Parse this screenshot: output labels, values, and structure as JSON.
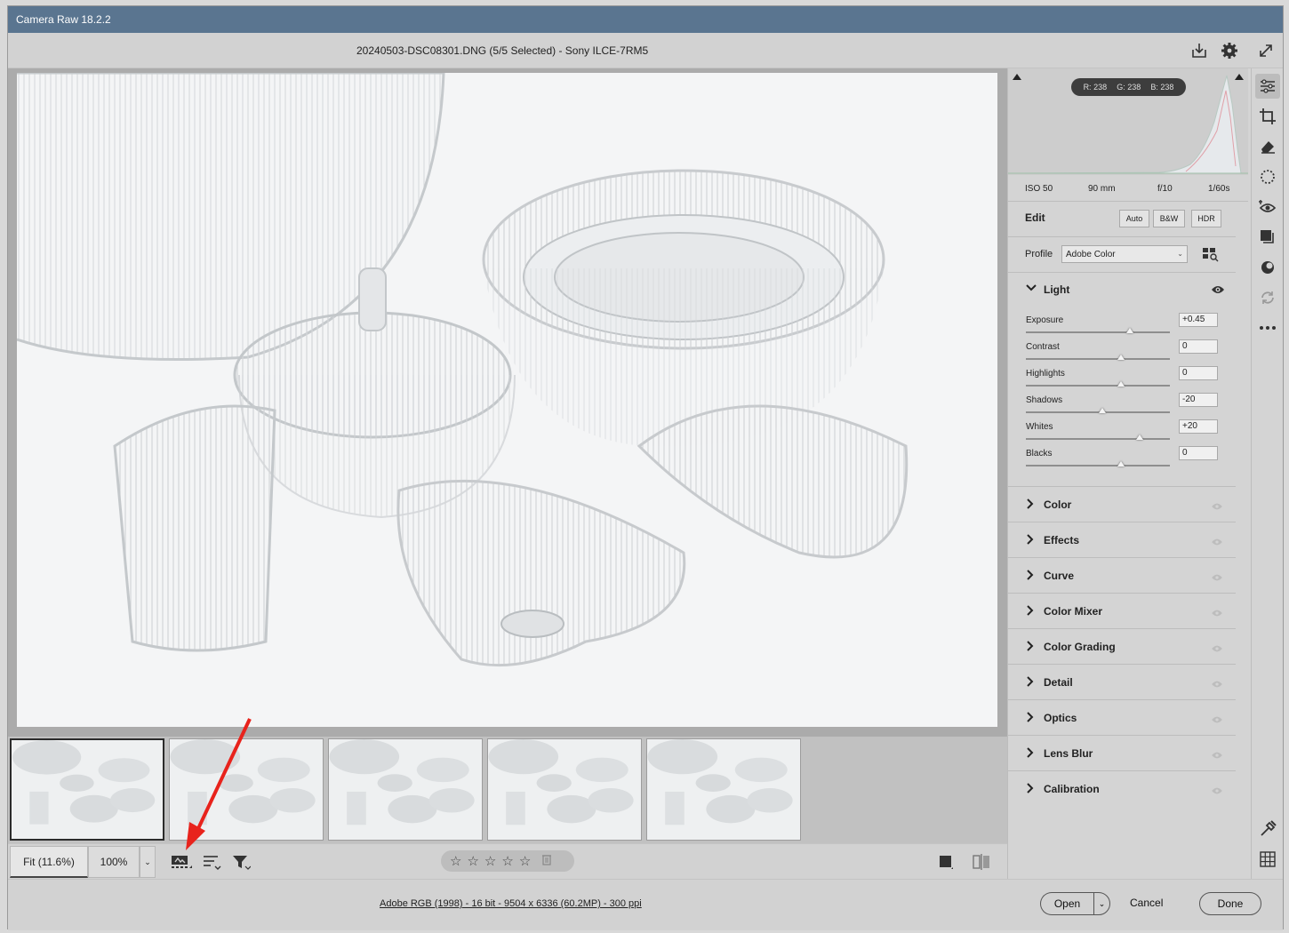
{
  "window": {
    "title": "Camera Raw 18.2.2"
  },
  "header": {
    "file_info": "20240503-DSC08301.DNG (5/5 Selected)  -  Sony ILCE-7RM5",
    "icons": [
      "save-icon",
      "gear-icon",
      "fullscreen-icon"
    ]
  },
  "filmstrip": {
    "thumbnails": [
      {
        "name": "thumb-1",
        "selected": true
      },
      {
        "name": "thumb-2",
        "selected": false
      },
      {
        "name": "thumb-3",
        "selected": false
      },
      {
        "name": "thumb-4",
        "selected": false
      },
      {
        "name": "thumb-5",
        "selected": false
      }
    ]
  },
  "bottombar": {
    "fit_label": "Fit (11.6%)",
    "zoom_label": "100%",
    "rating_stars": [
      "☆",
      "☆",
      "☆",
      "☆",
      "☆"
    ],
    "icons": [
      "filmstrip-icon",
      "sort-icon",
      "filter-icon",
      "trash-icon",
      "swatch-icon",
      "compare-icon"
    ]
  },
  "footer": {
    "workflow_link": "Adobe RGB (1998) - 16 bit - 9504 x 6336 (60.2MP) - 300 ppi",
    "open_label": "Open",
    "cancel_label": "Cancel",
    "done_label": "Done"
  },
  "histogram": {
    "r": "R: 238",
    "g": "G: 238",
    "b": "B: 238"
  },
  "exif": {
    "iso": "ISO 50",
    "focal": "90 mm",
    "aperture": "f/10",
    "shutter": "1/60s"
  },
  "edit": {
    "label": "Edit",
    "auto_label": "Auto",
    "bw_label": "B&W",
    "hdr_label": "HDR"
  },
  "profile": {
    "label": "Profile",
    "value": "Adobe Color"
  },
  "light": {
    "label": "Light",
    "sliders": [
      {
        "label": "Exposure",
        "value": "+0.45",
        "pos": 0.72
      },
      {
        "label": "Contrast",
        "value": "0",
        "pos": 0.66
      },
      {
        "label": "Highlights",
        "value": "0",
        "pos": 0.66
      },
      {
        "label": "Shadows",
        "value": "-20",
        "pos": 0.53
      },
      {
        "label": "Whites",
        "value": "+20",
        "pos": 0.79
      },
      {
        "label": "Blacks",
        "value": "0",
        "pos": 0.66
      }
    ]
  },
  "sections": [
    "Color",
    "Effects",
    "Curve",
    "Color Mixer",
    "Color Grading",
    "Detail",
    "Optics",
    "Lens Blur",
    "Calibration"
  ],
  "colors": {
    "titlebar": "#5a7590",
    "panel": "#d4d4d4",
    "arrow": "#e8231c"
  }
}
